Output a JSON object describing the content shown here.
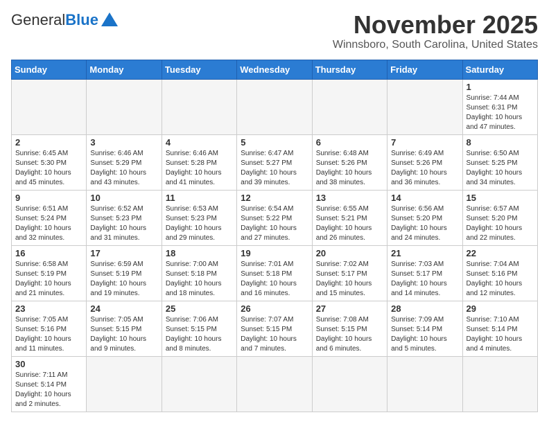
{
  "header": {
    "logo_general": "General",
    "logo_blue": "Blue",
    "month_year": "November 2025",
    "location": "Winnsboro, South Carolina, United States"
  },
  "days_of_week": [
    "Sunday",
    "Monday",
    "Tuesday",
    "Wednesday",
    "Thursday",
    "Friday",
    "Saturday"
  ],
  "weeks": [
    [
      {
        "day": "",
        "info": ""
      },
      {
        "day": "",
        "info": ""
      },
      {
        "day": "",
        "info": ""
      },
      {
        "day": "",
        "info": ""
      },
      {
        "day": "",
        "info": ""
      },
      {
        "day": "",
        "info": ""
      },
      {
        "day": "1",
        "info": "Sunrise: 7:44 AM\nSunset: 6:31 PM\nDaylight: 10 hours and 47 minutes."
      }
    ],
    [
      {
        "day": "2",
        "info": "Sunrise: 6:45 AM\nSunset: 5:30 PM\nDaylight: 10 hours and 45 minutes."
      },
      {
        "day": "3",
        "info": "Sunrise: 6:46 AM\nSunset: 5:29 PM\nDaylight: 10 hours and 43 minutes."
      },
      {
        "day": "4",
        "info": "Sunrise: 6:46 AM\nSunset: 5:28 PM\nDaylight: 10 hours and 41 minutes."
      },
      {
        "day": "5",
        "info": "Sunrise: 6:47 AM\nSunset: 5:27 PM\nDaylight: 10 hours and 39 minutes."
      },
      {
        "day": "6",
        "info": "Sunrise: 6:48 AM\nSunset: 5:26 PM\nDaylight: 10 hours and 38 minutes."
      },
      {
        "day": "7",
        "info": "Sunrise: 6:49 AM\nSunset: 5:26 PM\nDaylight: 10 hours and 36 minutes."
      },
      {
        "day": "8",
        "info": "Sunrise: 6:50 AM\nSunset: 5:25 PM\nDaylight: 10 hours and 34 minutes."
      }
    ],
    [
      {
        "day": "9",
        "info": "Sunrise: 6:51 AM\nSunset: 5:24 PM\nDaylight: 10 hours and 32 minutes."
      },
      {
        "day": "10",
        "info": "Sunrise: 6:52 AM\nSunset: 5:23 PM\nDaylight: 10 hours and 31 minutes."
      },
      {
        "day": "11",
        "info": "Sunrise: 6:53 AM\nSunset: 5:23 PM\nDaylight: 10 hours and 29 minutes."
      },
      {
        "day": "12",
        "info": "Sunrise: 6:54 AM\nSunset: 5:22 PM\nDaylight: 10 hours and 27 minutes."
      },
      {
        "day": "13",
        "info": "Sunrise: 6:55 AM\nSunset: 5:21 PM\nDaylight: 10 hours and 26 minutes."
      },
      {
        "day": "14",
        "info": "Sunrise: 6:56 AM\nSunset: 5:20 PM\nDaylight: 10 hours and 24 minutes."
      },
      {
        "day": "15",
        "info": "Sunrise: 6:57 AM\nSunset: 5:20 PM\nDaylight: 10 hours and 22 minutes."
      }
    ],
    [
      {
        "day": "16",
        "info": "Sunrise: 6:58 AM\nSunset: 5:19 PM\nDaylight: 10 hours and 21 minutes."
      },
      {
        "day": "17",
        "info": "Sunrise: 6:59 AM\nSunset: 5:19 PM\nDaylight: 10 hours and 19 minutes."
      },
      {
        "day": "18",
        "info": "Sunrise: 7:00 AM\nSunset: 5:18 PM\nDaylight: 10 hours and 18 minutes."
      },
      {
        "day": "19",
        "info": "Sunrise: 7:01 AM\nSunset: 5:18 PM\nDaylight: 10 hours and 16 minutes."
      },
      {
        "day": "20",
        "info": "Sunrise: 7:02 AM\nSunset: 5:17 PM\nDaylight: 10 hours and 15 minutes."
      },
      {
        "day": "21",
        "info": "Sunrise: 7:03 AM\nSunset: 5:17 PM\nDaylight: 10 hours and 14 minutes."
      },
      {
        "day": "22",
        "info": "Sunrise: 7:04 AM\nSunset: 5:16 PM\nDaylight: 10 hours and 12 minutes."
      }
    ],
    [
      {
        "day": "23",
        "info": "Sunrise: 7:05 AM\nSunset: 5:16 PM\nDaylight: 10 hours and 11 minutes."
      },
      {
        "day": "24",
        "info": "Sunrise: 7:05 AM\nSunset: 5:15 PM\nDaylight: 10 hours and 9 minutes."
      },
      {
        "day": "25",
        "info": "Sunrise: 7:06 AM\nSunset: 5:15 PM\nDaylight: 10 hours and 8 minutes."
      },
      {
        "day": "26",
        "info": "Sunrise: 7:07 AM\nSunset: 5:15 PM\nDaylight: 10 hours and 7 minutes."
      },
      {
        "day": "27",
        "info": "Sunrise: 7:08 AM\nSunset: 5:15 PM\nDaylight: 10 hours and 6 minutes."
      },
      {
        "day": "28",
        "info": "Sunrise: 7:09 AM\nSunset: 5:14 PM\nDaylight: 10 hours and 5 minutes."
      },
      {
        "day": "29",
        "info": "Sunrise: 7:10 AM\nSunset: 5:14 PM\nDaylight: 10 hours and 4 minutes."
      }
    ],
    [
      {
        "day": "30",
        "info": "Sunrise: 7:11 AM\nSunset: 5:14 PM\nDaylight: 10 hours and 2 minutes."
      },
      {
        "day": "",
        "info": ""
      },
      {
        "day": "",
        "info": ""
      },
      {
        "day": "",
        "info": ""
      },
      {
        "day": "",
        "info": ""
      },
      {
        "day": "",
        "info": ""
      },
      {
        "day": "",
        "info": ""
      }
    ]
  ]
}
